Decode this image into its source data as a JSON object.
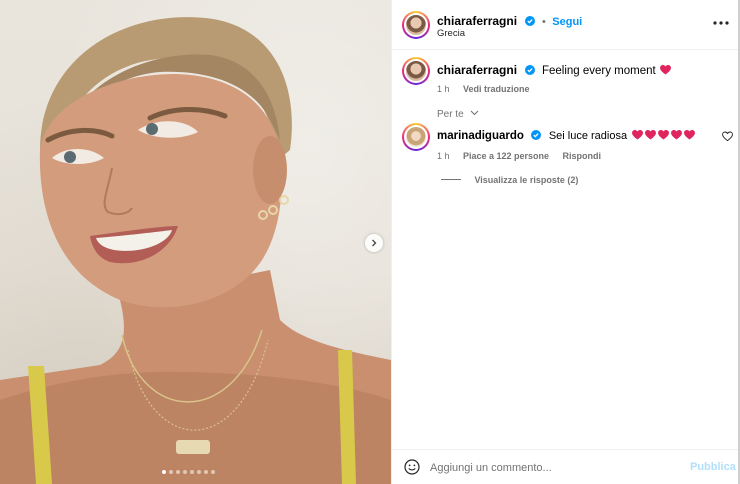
{
  "post": {
    "author": "chiaraferragni",
    "follow_label": "Segui",
    "separator": "•",
    "location": "Grecia",
    "more_icon": "more-horizontal-icon",
    "caption": {
      "username": "chiaraferragni",
      "text": "Feeling every moment",
      "emoji": "red-heart",
      "time": "1 h",
      "translate_label": "Vedi traduzione"
    },
    "sort_label": "Per te",
    "comments": [
      {
        "username": "marinadiguardo",
        "text": "Sei luce radiosa",
        "emoji_count": 5,
        "emoji": "red-heart",
        "time": "1 h",
        "likes_label": "Piace a 122 persone",
        "reply_label": "Rispondi",
        "view_replies_label": "Visualizza le risposte (2)"
      }
    ],
    "comment_box": {
      "placeholder": "Aggiungi un commento...",
      "publish_label": "Pubblica"
    },
    "carousel": {
      "slides": 8,
      "active_slide": 1
    },
    "colors": {
      "accent": "#0095f6",
      "heart": "#e0245e",
      "verified": "#0095f6"
    }
  }
}
